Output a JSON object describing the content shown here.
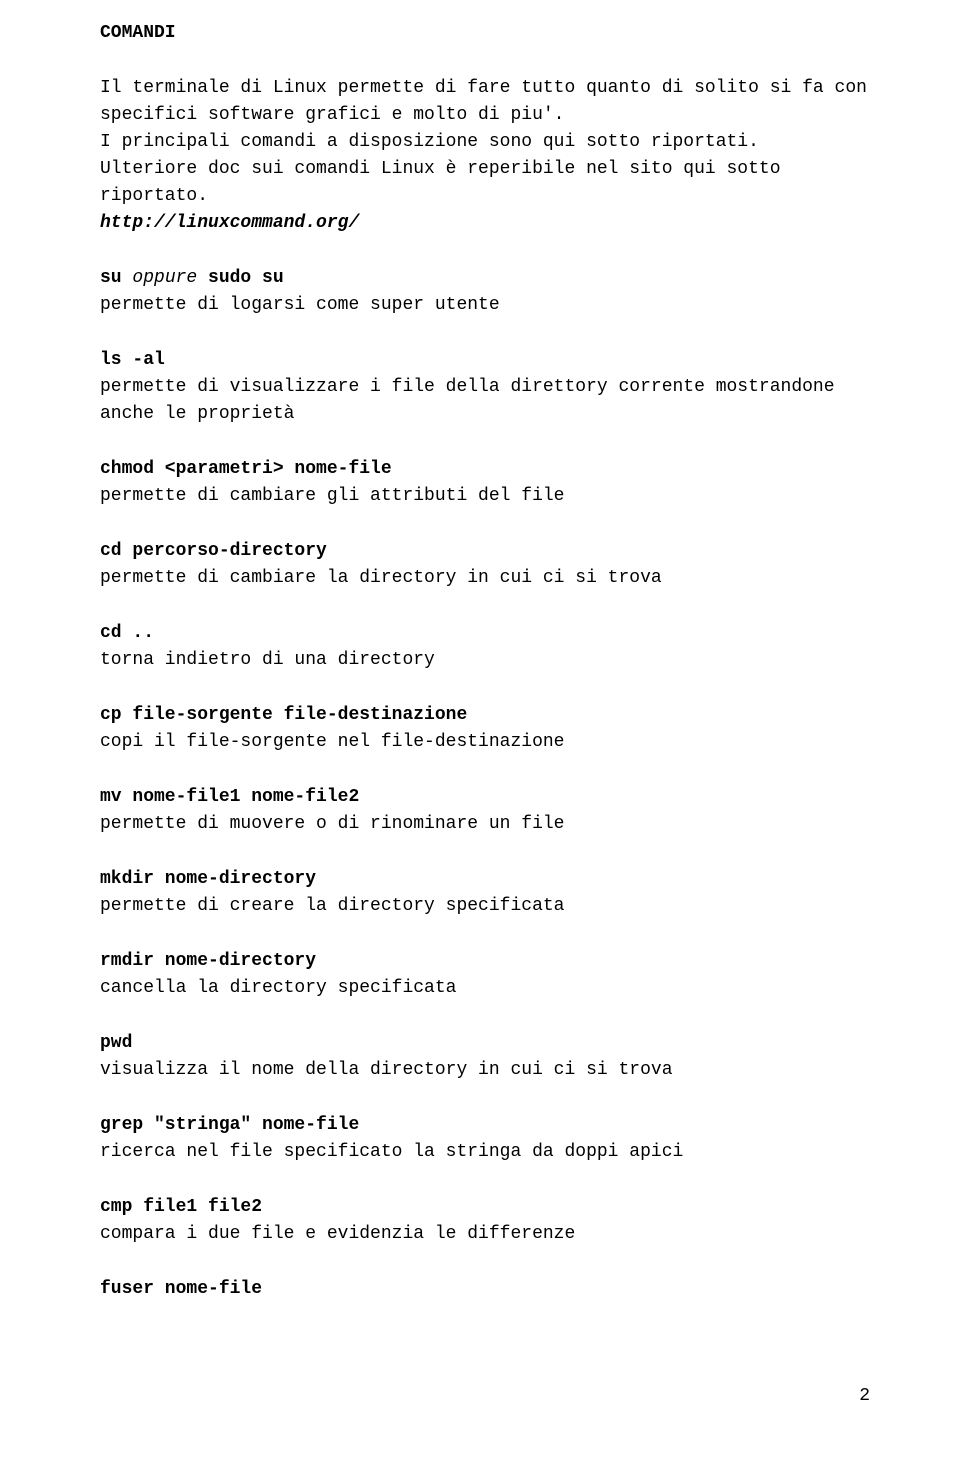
{
  "heading": "COMANDI",
  "intro_p1": "Il terminale di Linux permette di fare tutto quanto di solito si fa con specifici software grafici e molto di piu'.",
  "intro_p2": "I principali comandi a disposizione sono qui sotto riportati.",
  "intro_p3": "Ulteriore doc sui comandi Linux è reperibile nel sito qui sotto riportato.",
  "link": "http://linuxcommand.org/",
  "cmd_su_1": "su",
  "cmd_su_2": " oppure ",
  "cmd_su_3": "sudo su",
  "cmd_su_desc": "permette di logarsi come super utente",
  "cmd_ls": "ls -al",
  "cmd_ls_desc": "permette di visualizzare i file della direttory corrente mostrandone anche le proprietà",
  "cmd_chmod": "chmod <parametri> nome-file",
  "cmd_chmod_desc": "permette di cambiare gli attributi del file",
  "cmd_cd": "cd percorso-directory",
  "cmd_cd_desc": "permette di cambiare la directory in cui ci si trova",
  "cmd_cdup": "cd ..",
  "cmd_cdup_desc": "torna indietro di una directory",
  "cmd_cp": "cp file-sorgente file-destinazione",
  "cmd_cp_desc": "copi il file-sorgente nel file-destinazione",
  "cmd_mv": "mv nome-file1 nome-file2",
  "cmd_mv_desc": "permette di muovere o di rinominare un file",
  "cmd_mkdir": "mkdir nome-directory",
  "cmd_mkdir_desc": "permette di creare la directory specificata",
  "cmd_rmdir": "rmdir nome-directory",
  "cmd_rmdir_desc": "cancella la directory specificata",
  "cmd_pwd": "pwd",
  "cmd_pwd_desc": "visualizza il nome della directory in cui ci si trova",
  "cmd_grep": "grep \"stringa\" nome-file",
  "cmd_grep_desc": "ricerca nel file specificato la stringa da doppi apici",
  "cmd_cmp": "cmp file1 file2",
  "cmd_cmp_desc": "compara i due file e evidenzia le differenze",
  "cmd_fuser": "fuser nome-file",
  "page_number": "2"
}
